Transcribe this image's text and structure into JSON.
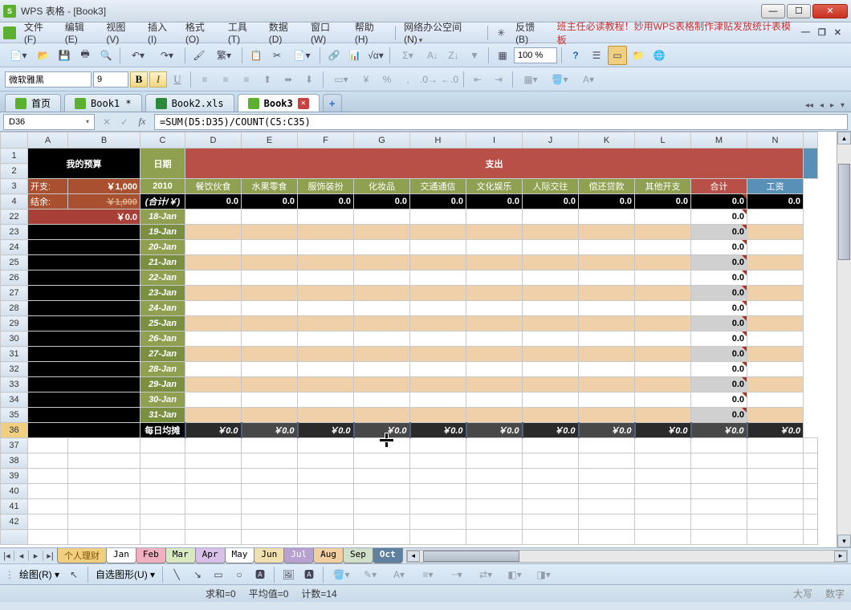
{
  "app": {
    "title": "WPS 表格 - [Book3]",
    "icon_text": "S"
  },
  "menus": [
    "文件(F)",
    "编辑(E)",
    "视图(V)",
    "插入(I)",
    "格式(O)",
    "工具(T)",
    "数据(D)",
    "窗口(W)",
    "帮助(H)"
  ],
  "menu_extra": {
    "net": "网络办公空间(N)",
    "feedback": "反馈(B)"
  },
  "promo": "班主任必读教程！妙用WPS表格制作津贴发放统计表模板",
  "toolbar": {
    "zoom": "100 %"
  },
  "format": {
    "font_name": "微软雅黑",
    "font_size": "9",
    "bold": "B",
    "italic": "I",
    "underline": "U"
  },
  "doctabs": {
    "home": "首页",
    "t1": "Book1 *",
    "t2": "Book2.xls",
    "t3": "Book3"
  },
  "namebox": "D36",
  "formula": "=SUM(D5:D35)/COUNT(C5:C35)",
  "cols": [
    "A",
    "B",
    "C",
    "D",
    "E",
    "F",
    "G",
    "H",
    "I",
    "J",
    "K",
    "L",
    "M",
    "N"
  ],
  "content": {
    "budget_title": "我的预算",
    "date_hdr": "日期",
    "expense_hdr": "支出",
    "expense_lbl": "开支:",
    "expense_val": "￥1,000",
    "balance_lbl": "结余:",
    "balance_val": "￥1,000",
    "year": "2010",
    "cats": [
      "餐饮伙食",
      "水果零食",
      "服饰装扮",
      "化妆品",
      "交通通信",
      "文化娱乐",
      "人际交往",
      "偿还贷款",
      "其他开支",
      "合计",
      "工资"
    ],
    "sum_lbl": "(合计/￥)",
    "zero": "0.0",
    "red_val": "￥0.0",
    "avg_lbl": "每日均摊",
    "avg_val": "￥0.0"
  },
  "rows_top": [
    "1",
    "2",
    "3",
    "4"
  ],
  "date_rows": [
    {
      "n": "22",
      "d": "18-Jan",
      "alt": false
    },
    {
      "n": "23",
      "d": "19-Jan",
      "alt": true
    },
    {
      "n": "24",
      "d": "20-Jan",
      "alt": false
    },
    {
      "n": "25",
      "d": "21-Jan",
      "alt": true
    },
    {
      "n": "26",
      "d": "22-Jan",
      "alt": false
    },
    {
      "n": "27",
      "d": "23-Jan",
      "alt": true
    },
    {
      "n": "28",
      "d": "24-Jan",
      "alt": false
    },
    {
      "n": "29",
      "d": "25-Jan",
      "alt": true
    },
    {
      "n": "30",
      "d": "26-Jan",
      "alt": false
    },
    {
      "n": "31",
      "d": "27-Jan",
      "alt": true
    },
    {
      "n": "32",
      "d": "28-Jan",
      "alt": false
    },
    {
      "n": "33",
      "d": "29-Jan",
      "alt": true
    },
    {
      "n": "34",
      "d": "30-Jan",
      "alt": false
    },
    {
      "n": "35",
      "d": "31-Jan",
      "alt": true
    }
  ],
  "rows_bottom": [
    "36",
    "37",
    "38",
    "39",
    "40",
    "41",
    "42"
  ],
  "sheets": [
    "个人理财",
    "Jan",
    "Feb",
    "Mar",
    "Apr",
    "May",
    "Jun",
    "Jul",
    "Aug",
    "Sep",
    "Oct"
  ],
  "draw": {
    "label": "绘图(R)",
    "autoshape": "自选图形(U)"
  },
  "status": {
    "sum": "求和=0",
    "avg": "平均值=0",
    "count": "计数=14",
    "caps": "大写",
    "num": "数字"
  }
}
